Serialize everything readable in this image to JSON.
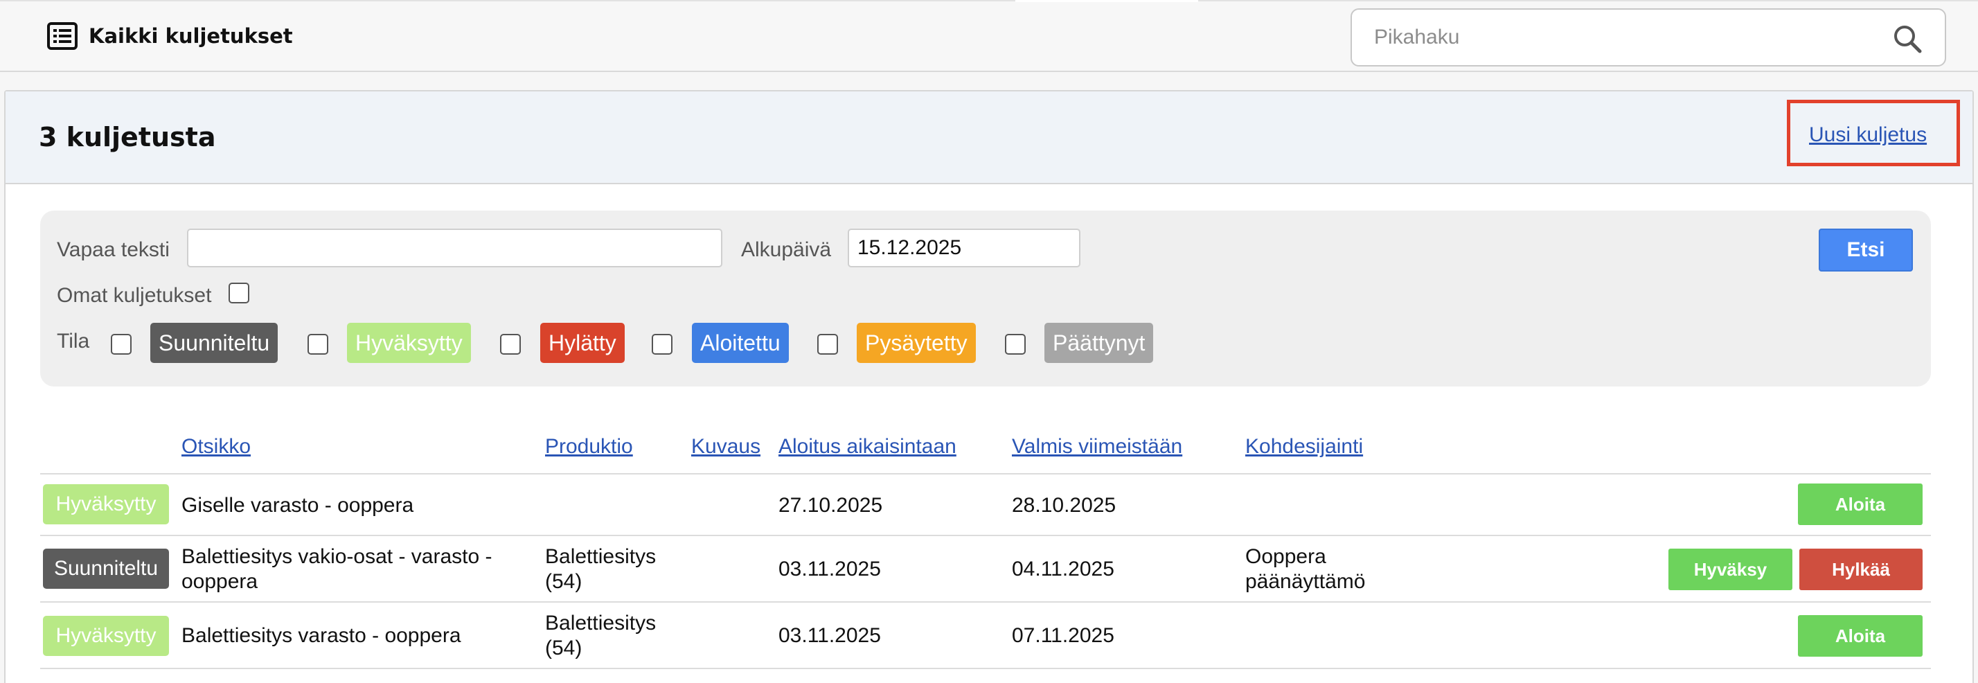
{
  "header": {
    "icon": "list-icon",
    "title": "Kaikki kuljetukset",
    "search": {
      "placeholder": "Pikahaku",
      "icon": "search-icon"
    }
  },
  "panel": {
    "title": "3 kuljetusta",
    "new_link": "Uusi kuljetus"
  },
  "filters": {
    "free_text_label": "Vapaa teksti",
    "free_text_value": "",
    "start_date_label": "Alkupäivä",
    "start_date_value": "15.12.2025",
    "own_label": "Omat kuljetukset",
    "status_label": "Tila",
    "statuses": [
      {
        "label": "Suunniteltu",
        "color": "#5c5c5c"
      },
      {
        "label": "Hyväksytty",
        "color": "#b8e986"
      },
      {
        "label": "Hylätty",
        "color": "#d9432b"
      },
      {
        "label": "Aloitettu",
        "color": "#3f7fe3"
      },
      {
        "label": "Pysäytetty",
        "color": "#f5a623"
      },
      {
        "label": "Päättynyt",
        "color": "#a6a6a6"
      }
    ],
    "search_button": "Etsi"
  },
  "table": {
    "columns": [
      "Otsikko",
      "Produktio",
      "Kuvaus",
      "Aloitus aikaisintaan",
      "Valmis viimeistään",
      "Kohdesijainti"
    ],
    "rows": [
      {
        "status": "Hyväksytty",
        "title": "Giselle varasto - ooppera",
        "production": "",
        "description": "",
        "start": "27.10.2025",
        "end": "28.10.2025",
        "location": "",
        "actions": [
          "Aloita"
        ]
      },
      {
        "status": "Suunniteltu",
        "title": "Balettiesitys vakio-osat - varasto - ooppera",
        "production": "Balettiesitys (54)",
        "description": "",
        "start": "03.11.2025",
        "end": "04.11.2025",
        "location": "Ooppera päänäyttämö",
        "actions": [
          "Hyväksy",
          "Hylkää"
        ]
      },
      {
        "status": "Hyväksytty",
        "title": "Balettiesitys varasto - ooppera",
        "production": "Balettiesitys (54)",
        "description": "",
        "start": "03.11.2025",
        "end": "07.11.2025",
        "location": "",
        "actions": [
          "Aloita"
        ]
      }
    ]
  },
  "colors": {
    "accent_blue": "#4a8af4",
    "link": "#2a55b5",
    "green_button": "#6dd35c",
    "red_button": "#cf4f3f",
    "highlight_box": "#e2412c"
  }
}
